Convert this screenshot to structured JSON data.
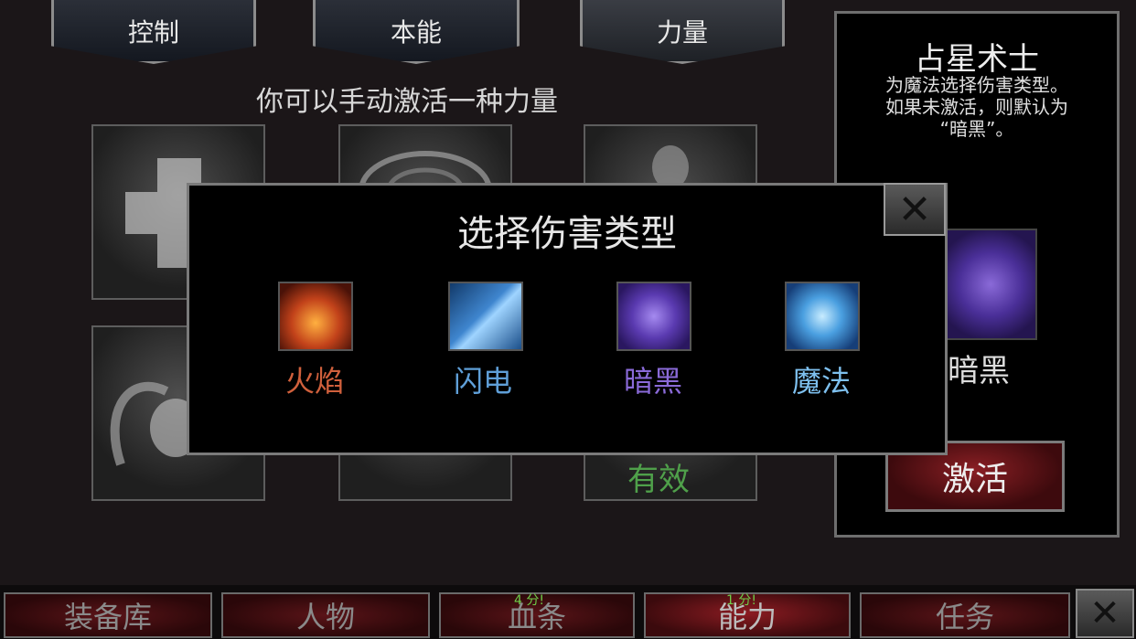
{
  "top_tabs": [
    {
      "label": "控制"
    },
    {
      "label": "本能"
    },
    {
      "label": "力量"
    }
  ],
  "hint": "你可以手动激活一种力量",
  "grid_status": "有效",
  "right_panel": {
    "title": "占星术士",
    "description": "为魔法选择伤害类型。\n如果未激活，则默认为\n“暗黑”。",
    "selected_name": "暗黑",
    "activate_label": "激活"
  },
  "modal": {
    "title": "选择伤害类型",
    "close_glyph": "✕",
    "options": [
      {
        "label": "火焰",
        "color": "#d0603c",
        "icon": "fire-icon"
      },
      {
        "label": "闪电",
        "color": "#5f9fd8",
        "icon": "lightning-icon"
      },
      {
        "label": "暗黑",
        "color": "#8a6ad8",
        "icon": "dark-icon"
      },
      {
        "label": "魔法",
        "color": "#7ec0ef",
        "icon": "magic-icon"
      }
    ]
  },
  "bottom_tabs": [
    {
      "label": "装备库"
    },
    {
      "label": "人物"
    },
    {
      "label": "血条",
      "points": "4 分!"
    },
    {
      "label": "能力",
      "points": "1 分!"
    },
    {
      "label": "任务"
    }
  ],
  "bottom_close_glyph": "✕"
}
